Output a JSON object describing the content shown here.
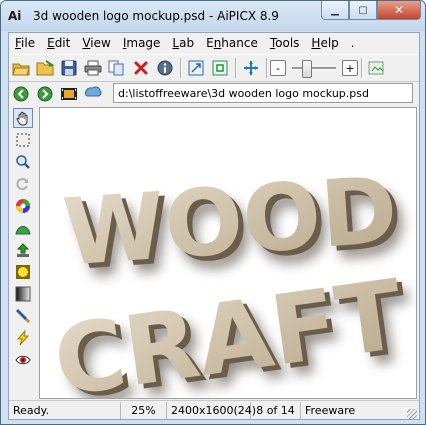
{
  "window": {
    "title": "3d wooden logo mockup.psd - AiPICX 8.9",
    "app_icon_text": "Ai",
    "caption": {
      "minimize": "▁",
      "maximize": "▢",
      "close": "✕"
    }
  },
  "menu": [
    {
      "label": "File",
      "mnemonic": "F",
      "rest": "ile"
    },
    {
      "label": "Edit",
      "mnemonic": "E",
      "rest": "dit"
    },
    {
      "label": "View",
      "mnemonic": "V",
      "rest": "iew"
    },
    {
      "label": "Image",
      "mnemonic": "I",
      "rest": "mage"
    },
    {
      "label": "Lab",
      "mnemonic": "L",
      "rest": "ab"
    },
    {
      "label": "Enhance",
      "mnemonic": "n",
      "pre": "E",
      "rest": "hance"
    },
    {
      "label": "Tools",
      "mnemonic": "T",
      "rest": "ools"
    },
    {
      "label": "Help",
      "mnemonic": "H",
      "rest": "elp"
    }
  ],
  "menu_trailing": ".",
  "toolbar": {
    "zoom_out": "-",
    "zoom_in": "+",
    "zoom_slider_level": 0.35,
    "icons": [
      "open-folder-icon",
      "browse-folder-icon",
      "save-icon",
      "print-icon",
      "copy-icon",
      "delete-icon",
      "info-icon",
      "fit-window-icon",
      "actual-size-icon",
      "fullscreen-icon",
      "export-icon"
    ]
  },
  "nav": {
    "path": "d:\\listoffreeware\\3d wooden logo mockup.psd"
  },
  "image": {
    "line1": "WOOD",
    "line2": "CRAFT"
  },
  "status": {
    "state": "Ready.",
    "zoom": "25%",
    "dimensions": "2400x1600(24)",
    "position": "8 of 14",
    "license": "Freeware"
  },
  "colors": {
    "wood_light": "#d8ccb6",
    "wood_dark": "#6b5d4a",
    "title_bar": "#c3d7ec",
    "close_button": "#c4462a"
  }
}
